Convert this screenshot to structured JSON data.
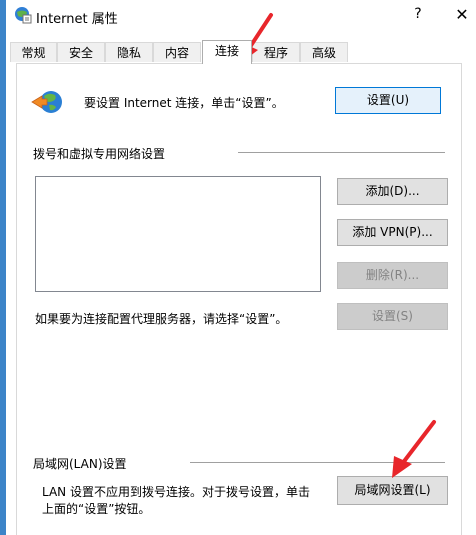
{
  "window": {
    "title": "Internet 属性",
    "help_glyph": "?",
    "close_glyph": "✕"
  },
  "tabs": [
    {
      "label": "常规"
    },
    {
      "label": "安全"
    },
    {
      "label": "隐私"
    },
    {
      "label": "内容"
    },
    {
      "label": "连接",
      "active": true
    },
    {
      "label": "程序"
    },
    {
      "label": "高级"
    }
  ],
  "connect": {
    "setup_text": "要设置 Internet 连接，单击“设置”。",
    "setup_button": "设置(U)"
  },
  "dialup": {
    "section_label": "拨号和虚拟专用网络设置",
    "connections": [],
    "add_button": "添加(D)...",
    "add_vpn_button": "添加 VPN(P)...",
    "remove_button": "删除(R)...",
    "proxy_text": "如果要为连接配置代理服务器，请选择“设置”。",
    "settings_button": "设置(S)"
  },
  "lan": {
    "section_label": "局域网(LAN)设置",
    "description": "LAN 设置不应用到拨号连接。对于拨号设置，单击上面的“设置”按钮。",
    "button": "局域网设置(L)"
  },
  "colors": {
    "accent": "#0078d7",
    "annotation_arrow": "#e8262b",
    "left_strip": "#3c84c8"
  }
}
